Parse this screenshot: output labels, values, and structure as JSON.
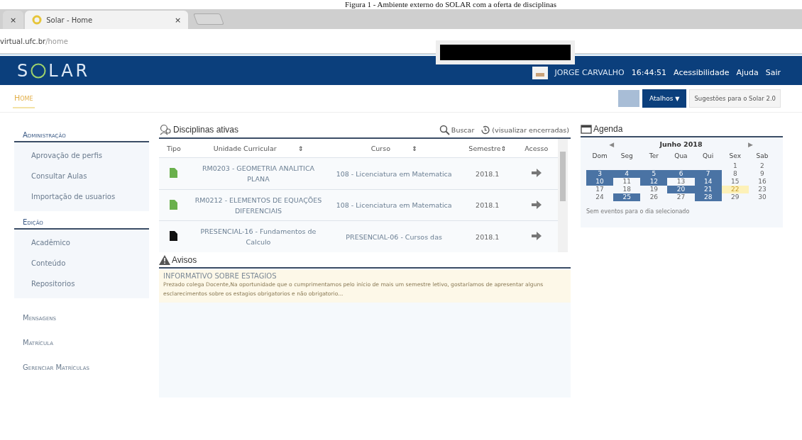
{
  "caption": "Figura 1 - Ambiente externo do SOLAR com a oferta de disciplinas",
  "browser": {
    "tabs": [
      {
        "selected": false
      },
      {
        "label": "Solar - Home",
        "selected": true
      }
    ],
    "close_glyph": "×",
    "address_host": "virtual.ufc.br",
    "address_path": "/home"
  },
  "header": {
    "logo": [
      "S",
      "LAR"
    ],
    "user": "JORGE CARVALHO",
    "time": "16:44:51",
    "links": [
      "Acessibilidade",
      "Ajuda",
      "Sair"
    ]
  },
  "breadcrumb": "Home",
  "toolbar": {
    "shortcuts": "Atalhos",
    "shortcuts_caret": "▼",
    "suggestions": "Sugestões para o Solar 2.0"
  },
  "sidebar": [
    {
      "kind": "section",
      "label": "Administração",
      "children": [
        {
          "label": "Aprovação de perfis"
        },
        {
          "label": "Consultar Aulas"
        },
        {
          "label": "Importação de usuarios"
        }
      ]
    },
    {
      "kind": "section",
      "label": "Edição",
      "children": [
        {
          "label": "Acadêmico"
        },
        {
          "label": "Conteúdo"
        },
        {
          "label": "Repositorios"
        }
      ]
    },
    {
      "kind": "link",
      "label": "Mensagens"
    },
    {
      "kind": "link",
      "label": "Matrícula"
    },
    {
      "kind": "link",
      "label": "Gerenciar Matrículas"
    }
  ],
  "courses": {
    "title": "Disciplinas ativas",
    "search": "Buscar",
    "closed": "(visualizar encerradas)",
    "columns": [
      {
        "label": "Tipo",
        "sortable": false
      },
      {
        "label": "Unidade Curricular",
        "sortable": true
      },
      {
        "label": "Curso",
        "sortable": true
      },
      {
        "label": "Semestre",
        "sortable": true
      },
      {
        "label": "Acesso",
        "sortable": false
      }
    ],
    "sort_glyph": "⇕",
    "rows": [
      {
        "color": "#6ab04c",
        "unit": "RM0203 - GEOMETRIA ANALITICA PLANA",
        "course": "108 - Licenciatura em Matematica",
        "semester": "2018.1"
      },
      {
        "color": "#6ab04c",
        "unit": "RM0212 - ELEMENTOS DE EQUAÇÕES DIFERENCIAIS",
        "course": "108 - Licenciatura em Matematica",
        "semester": "2018.1"
      },
      {
        "color": "#111111",
        "unit": "PRESENCIAL-16 - Fundamentos de Calculo",
        "course": "PRESENCIAL-06 - Cursos das",
        "semester": "2018.1"
      }
    ]
  },
  "notices": {
    "title": "Avisos",
    "items": [
      {
        "title": "INFORMATIVO SOBRE ESTAGIOS",
        "text": "Prezado colega Docente,Na oportunidade que o cumprimentamos pelo início de mais um semestre letivo, gostaríamos de apresentar alguns esclarecimentos sobre os estagios obrigatorios e não obrigatorio..."
      }
    ]
  },
  "agenda": {
    "title": "Agenda",
    "prev": "◀",
    "next": "▶",
    "month": "Junho 2018",
    "weekdays": [
      "Dom",
      "Seg",
      "Ter",
      "Qua",
      "Qui",
      "Sex",
      "Sab"
    ],
    "weeks": [
      [
        {
          "day": "1",
          "marked": false,
          "today": false
        },
        {
          "day": "2",
          "marked": false,
          "today": false
        }
      ],
      [
        {
          "day": "3",
          "marked": true,
          "today": false
        },
        {
          "day": "4",
          "marked": true,
          "today": false
        },
        {
          "day": "5",
          "marked": true,
          "today": false
        },
        {
          "day": "6",
          "marked": true,
          "today": false
        },
        {
          "day": "7",
          "marked": true,
          "today": false
        },
        {
          "day": "8",
          "marked": false,
          "today": false
        },
        {
          "day": "9",
          "marked": false,
          "today": false
        }
      ],
      [
        {
          "day": "10",
          "marked": true,
          "today": false
        },
        {
          "day": "11",
          "marked": false,
          "today": false
        },
        {
          "day": "12",
          "marked": true,
          "today": false
        },
        {
          "day": "13",
          "marked": false,
          "today": false
        },
        {
          "day": "14",
          "marked": true,
          "today": false
        },
        {
          "day": "15",
          "marked": false,
          "today": false
        },
        {
          "day": "16",
          "marked": false,
          "today": false
        }
      ],
      [
        {
          "day": "17",
          "marked": false,
          "today": false
        },
        {
          "day": "18",
          "marked": false,
          "today": false
        },
        {
          "day": "19",
          "marked": false,
          "today": false
        },
        {
          "day": "20",
          "marked": true,
          "today": false
        },
        {
          "day": "21",
          "marked": true,
          "today": false
        },
        {
          "day": "22",
          "marked": false,
          "today": true
        },
        {
          "day": "23",
          "marked": false,
          "today": false
        }
      ],
      [
        {
          "day": "24",
          "marked": false,
          "today": false
        },
        {
          "day": "25",
          "marked": true,
          "today": false
        },
        {
          "day": "26",
          "marked": false,
          "today": false
        },
        {
          "day": "27",
          "marked": false,
          "today": false
        },
        {
          "day": "28",
          "marked": true,
          "today": false
        },
        {
          "day": "29",
          "marked": false,
          "today": false
        },
        {
          "day": "30",
          "marked": false,
          "today": false
        }
      ]
    ],
    "empty": "Sem eventos para o dia selecionado"
  }
}
